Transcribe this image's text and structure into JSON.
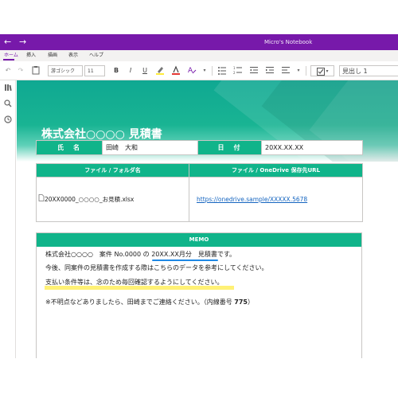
{
  "window": {
    "title": "Micro's Notebook",
    "back_glyph": "←",
    "forward_glyph": "→",
    "accent_color": "#7719aa"
  },
  "menu": {
    "items": [
      {
        "label": "ホーム",
        "active": true
      },
      {
        "label": "挿入"
      },
      {
        "label": "描画"
      },
      {
        "label": "表示"
      },
      {
        "label": "ヘルプ"
      }
    ]
  },
  "toolbar": {
    "font_name": "游ゴシック",
    "font_size": "11",
    "bold": "B",
    "italic": "I",
    "underline": "U",
    "heading_style": "見出し 1",
    "icons": [
      "undo-icon",
      "redo-icon",
      "clipboard-icon",
      "bold-icon",
      "italic-icon",
      "underline-icon",
      "highlight-icon",
      "font-color-icon",
      "clear-format-icon",
      "bullets-icon",
      "numbering-icon",
      "outdent-icon",
      "indent-icon",
      "align-icon",
      "checkbox-icon",
      "styles-dropdown-icon"
    ]
  },
  "rail": {
    "icons": [
      "notebooks-icon",
      "search-icon",
      "recent-icon"
    ]
  },
  "document": {
    "title": "株式会社○○○○ 見積書",
    "brand_color": "#10b48a",
    "info_table": {
      "name_label": "氏　名",
      "name_value": "田崎　大和",
      "date_label": "日　付",
      "date_value": "20XX.XX.XX"
    },
    "file_table": {
      "file_header": "ファイル / フォルダ名",
      "url_header": "ファイル / OneDrive 保存先URL",
      "file_name": "20XX0000_○○○○_お見積.xlsx",
      "file_icon": "document-icon",
      "url": "https://onedrive.sample/XXXXX.5678"
    },
    "memo": {
      "header": "MEMO",
      "line1_prefix": "株式会社○○○○　案件 No.0000 の ",
      "line1_highlight": "20XX.XX月分　見積書",
      "line1_suffix": "です。",
      "line2": "今後、同案件の見積書を作成する際はこちらのデータを参考にしてください。",
      "line3": "支払い条件等は、念のため毎回確認するようにしてください。",
      "line4_prefix": "※不明点などありましたら、田崎までご連絡ください。（内線番号 ",
      "line4_ext": "775",
      "line4_suffix": "）",
      "highlight_color": "#fff176",
      "underline_color": "#1e88e5"
    }
  }
}
